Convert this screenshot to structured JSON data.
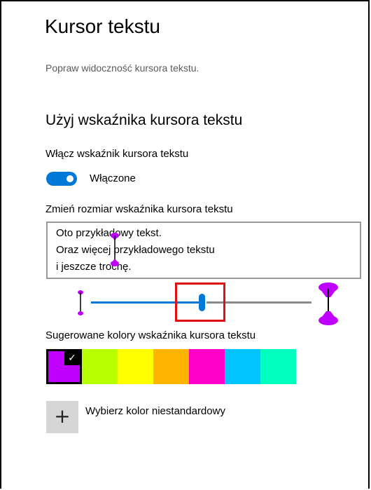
{
  "page": {
    "title": "Kursor tekstu",
    "subtitle": "Popraw widoczność kursora tekstu."
  },
  "indicator": {
    "section_title": "Użyj wskaźnika kursora tekstu",
    "toggle_label": "Włącz wskaźnik kursora tekstu",
    "toggle_state": "Włączone",
    "toggle_on": true,
    "size_label": "Zmień rozmiar wskaźnika kursora tekstu",
    "preview_lines": [
      "Oto przykładowy tekst.",
      "Oraz więcej przykładowego tekstu",
      "i jeszcze trochę."
    ],
    "size_level": 0.5,
    "accent_color": "#0078d7",
    "indicator_color": "#c000ff"
  },
  "colors": {
    "label": "Sugerowane kolory wskaźnika kursora tekstu",
    "swatches": [
      "#c000ff",
      "#b8ff00",
      "#ffff00",
      "#ffb400",
      "#ff00c8",
      "#00c4ff",
      "#00ffbf"
    ],
    "selected_index": 0,
    "custom_label": "Wybierz kolor niestandardowy",
    "custom_icon": "plus-icon"
  }
}
